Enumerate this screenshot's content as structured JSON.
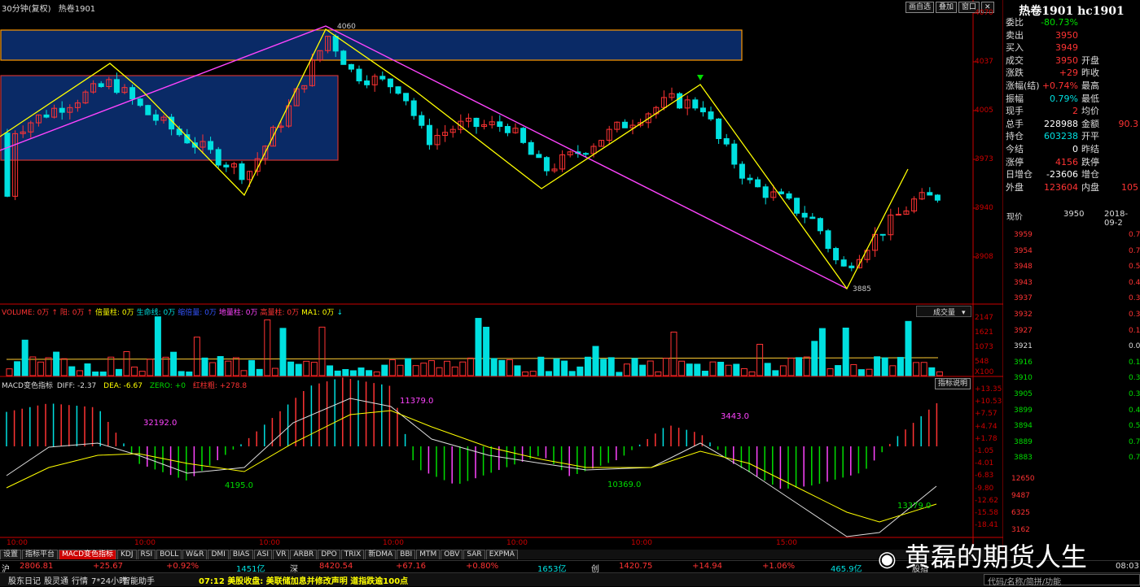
{
  "header": {
    "period_label": "30分钟(复权)",
    "symbol_name": "热卷1901",
    "buttons": [
      "画自选",
      "叠加",
      "窗口"
    ],
    "close_icon": "close-icon"
  },
  "price_axis": [
    "4070",
    "4037",
    "4005",
    "3973",
    "3940",
    "3908"
  ],
  "annotations": {
    "high": "4060",
    "low": "3885"
  },
  "volume_panel": {
    "legend": [
      {
        "text": "VOLUME: 0万",
        "color": "#ff3333"
      },
      {
        "text": "↑",
        "color": "#ff3333"
      },
      {
        "text": "阳: 0万",
        "color": "#ff3333"
      },
      {
        "text": "↑",
        "color": "#ff3333"
      },
      {
        "text": "倍量柱: 0万",
        "color": "#ffff00"
      },
      {
        "text": "生命线: 0万",
        "color": "#00e0e0"
      },
      {
        "text": "缩倍量: 0万",
        "color": "#3355ff"
      },
      {
        "text": "地量柱: 0万",
        "color": "#ff44ff"
      },
      {
        "text": "高量柱: 0万",
        "color": "#ff3333"
      },
      {
        "text": "MA1: 0万",
        "color": "#ffff00"
      },
      {
        "text": "↓",
        "color": "#00e0e0"
      }
    ],
    "dropdown": "成交量",
    "axis": [
      "2147",
      "1621",
      "1073",
      "548",
      "X100"
    ]
  },
  "macd_panel": {
    "title": "MACD变色指标",
    "diff": "DIFF: -2.37",
    "dea": "DEA: -6.67",
    "zero": "ZERO: +0",
    "red_col": "红柱粗: +278.8",
    "help_button": "指标说明",
    "axis": [
      "+13.35",
      "+10.53",
      "+7.57",
      "+4.74",
      "+1.78",
      "-1.05",
      "-4.01",
      "-6.83",
      "-9.80",
      "-12.62",
      "-15.58",
      "-18.41"
    ],
    "labels": [
      {
        "text": "32192.0",
        "color": "#ff44ff"
      },
      {
        "text": "11379.0",
        "color": "#ff44ff"
      },
      {
        "text": "3443.0",
        "color": "#ff44ff"
      },
      {
        "text": "4195.0",
        "color": "#00dd00"
      },
      {
        "text": "10369.0",
        "color": "#00dd00"
      },
      {
        "text": "13379.0",
        "color": "#00dd00"
      }
    ]
  },
  "time_axis": [
    "10:00",
    "10:00",
    "10:00",
    "10:00",
    "10:00",
    "10:00",
    "15:00"
  ],
  "tabs": [
    "设置",
    "指标平台",
    "MACD变色指标",
    "KDJ",
    "RSI",
    "BOLL",
    "W&R",
    "DMI",
    "BIAS",
    "ASI",
    "VR",
    "ARBR",
    "DPO",
    "TRIX",
    "新DMA",
    "BBI",
    "MTM",
    "OBV",
    "SAR",
    "EXPMA"
  ],
  "quote": {
    "title": "热卷1901 hc1901",
    "rows": [
      {
        "l1": "委比",
        "v1": "-80.73%",
        "c1": "grn"
      },
      {
        "l1": "卖出",
        "v1": "3950",
        "c1": "red"
      },
      {
        "l1": "买入",
        "v1": "3949",
        "c1": "red"
      },
      {
        "l1": "成交",
        "v1": "3950",
        "c1": "red",
        "l2": "开盘"
      },
      {
        "l1": "涨跌",
        "v1": "+29",
        "c1": "red",
        "l2": "昨收"
      },
      {
        "l1": "涨幅(结)",
        "v1": "+0.74%",
        "c1": "red",
        "l2": "最高"
      },
      {
        "l1": "振幅",
        "v1": "0.79%",
        "c1": "cyan",
        "l2": "最低"
      },
      {
        "l1": "现手",
        "v1": "2",
        "c1": "red",
        "l2": "均价"
      },
      {
        "l1": "总手",
        "v1": "228988",
        "c1": "wht",
        "l2": "金额",
        "v2": "90.3"
      },
      {
        "l1": "持仓",
        "v1": "603238",
        "c1": "cyan",
        "l2": "开平"
      },
      {
        "l1": "今结",
        "v1": "0",
        "c1": "wht",
        "l2": "昨结"
      },
      {
        "l1": "涨停",
        "v1": "4156",
        "c1": "red",
        "l2": "跌停"
      },
      {
        "l1": "日增仓",
        "v1": "-23606",
        "c1": "wht",
        "l2": "增仓"
      },
      {
        "l1": "外盘",
        "v1": "123604",
        "c1": "red",
        "l2": "内盘",
        "v2": "105"
      }
    ],
    "mini": {
      "now_label": "现价",
      "now_value": "3950",
      "date": "2018-09-2",
      "price_axis": [
        "3959",
        "3954",
        "3948",
        "3943",
        "3937",
        "3932",
        "3927",
        "3921",
        "3916",
        "3910",
        "3905",
        "3899",
        "3894",
        "3889",
        "3883"
      ],
      "pct_axis": [
        "0.7",
        "0.7",
        "0.5",
        "0.4",
        "0.3",
        "0.3",
        "0.1",
        "0.0",
        "0.1",
        "0.3",
        "0.3",
        "0.4",
        "0.5",
        "0.7",
        "0.7"
      ],
      "vol_axis": [
        "12650",
        "9487",
        "6325",
        "3162"
      ]
    }
  },
  "status_bar": {
    "index1": {
      "name": "沪",
      "value": "2806.81",
      "chg": "+25.67",
      "pct": "+0.92%",
      "amt": "1451亿"
    },
    "index2": {
      "name": "深",
      "value": "8420.54",
      "chg": "+67.16",
      "pct": "+0.80%",
      "amt": "1653亿"
    },
    "index3": {
      "name": "创",
      "value": "1420.75",
      "chg": "+14.94",
      "pct": "+1.06%",
      "amt": "465.9亿"
    },
    "extra": "股指",
    "time_right": "08:03"
  },
  "footer": {
    "items": [
      "股东日记",
      "股灵通",
      "行情",
      "7*24小时",
      "智能助手"
    ],
    "news": "07:12 美股收盘: 美联储加息并修改声明 道指跌逾100点",
    "search_hint": "代码/名称/简拼/功能"
  },
  "watermark": "黄磊的期货人生",
  "colors": {
    "up": "#ff3333",
    "down": "#00e0e0",
    "magenta": "#ff44ff",
    "yellow": "#ffff00",
    "box_border": "#ff9900",
    "box_fill": "#0a2a66"
  }
}
